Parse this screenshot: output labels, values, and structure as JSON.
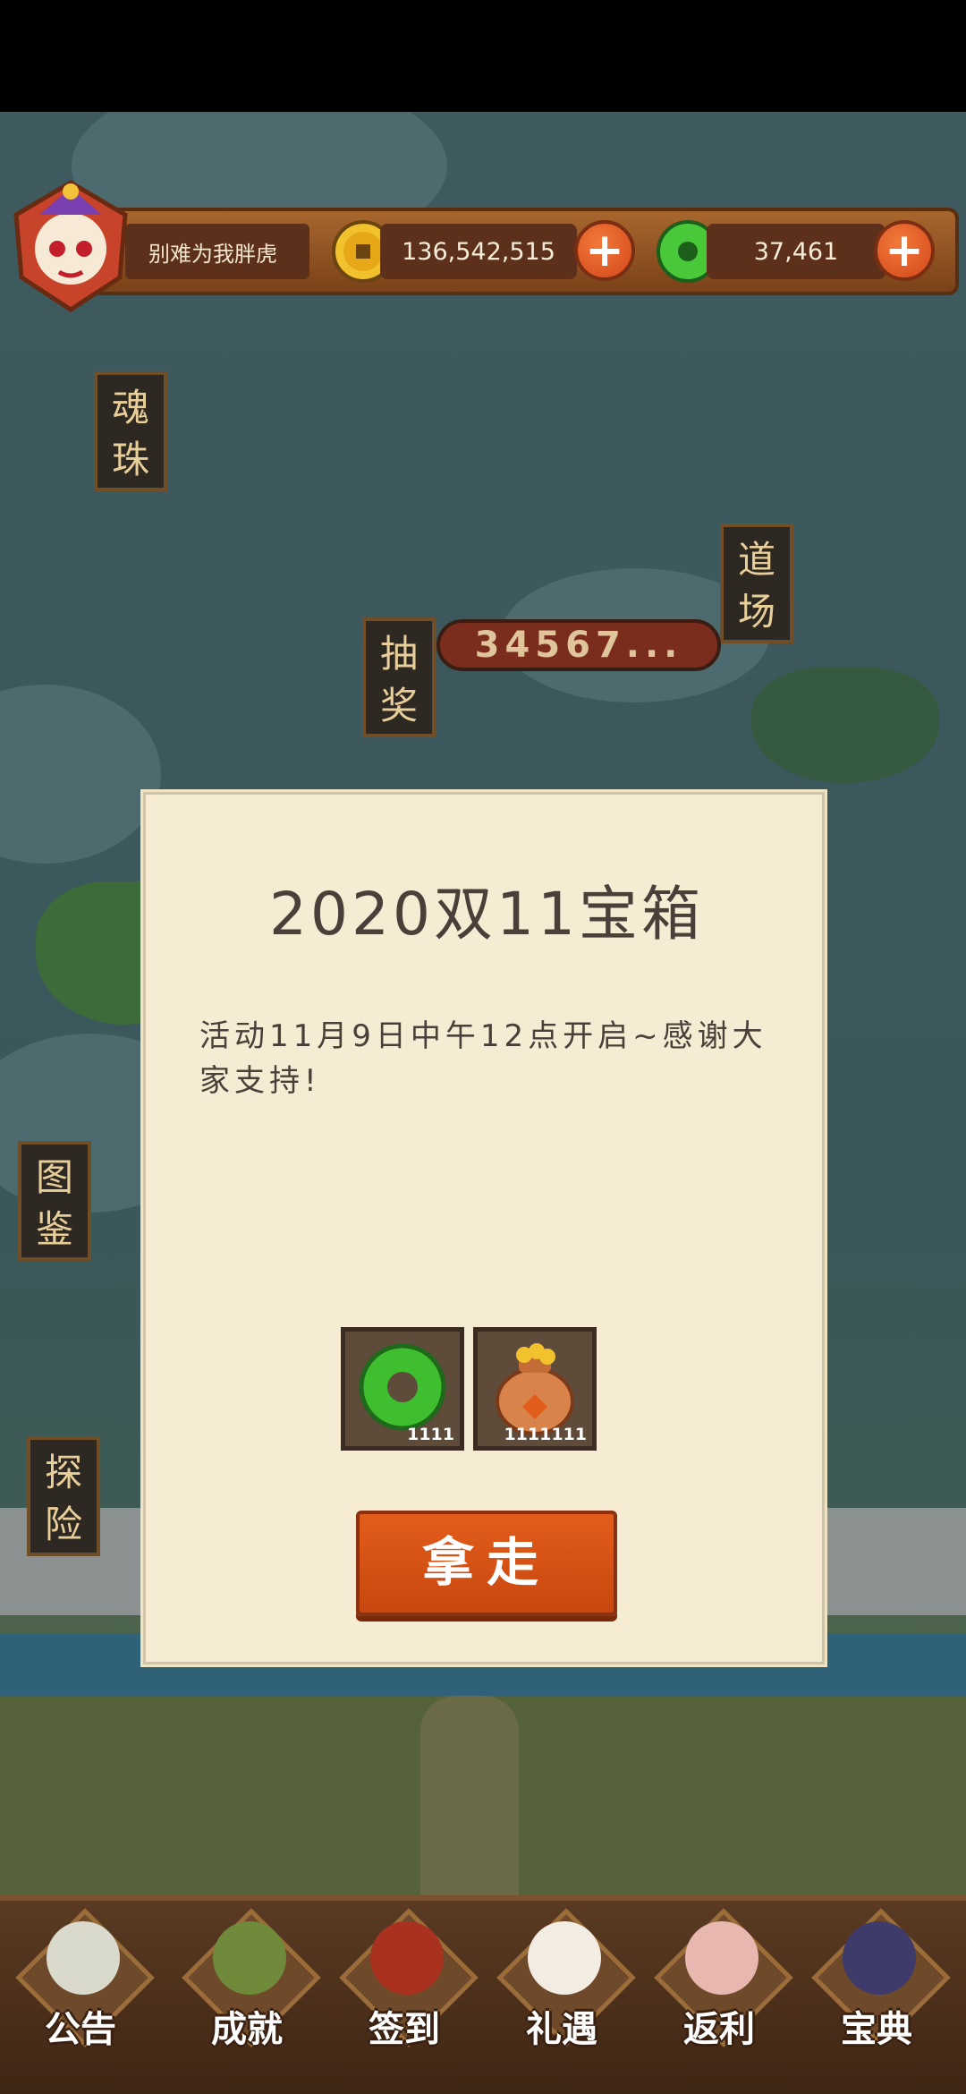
{
  "header": {
    "player_name": "别难为我胖虎",
    "gold_amount": "136,542,515",
    "jade_amount": "37,461",
    "plus_label": "+"
  },
  "side_menu": {
    "soul_orb": "魂珠",
    "dojo": "道场",
    "lottery": "抽奖",
    "codex": "图鉴",
    "explore": "探险"
  },
  "lottery_counter": "34567...",
  "modal": {
    "title": "2020双11宝箱",
    "body": "活动11月9日中午12点开启~感谢大家支持!",
    "rewards": [
      {
        "icon": "jade-ring-icon",
        "count": "1111"
      },
      {
        "icon": "coin-bag-icon",
        "count": "1111111"
      }
    ],
    "take_button": "拿走"
  },
  "bottom_nav": [
    {
      "label": "公告",
      "icon": "announcement-icon"
    },
    {
      "label": "成就",
      "icon": "achievement-icon"
    },
    {
      "label": "签到",
      "icon": "checkin-icon"
    },
    {
      "label": "礼遇",
      "icon": "gift-icon"
    },
    {
      "label": "返利",
      "icon": "rebate-icon"
    },
    {
      "label": "宝典",
      "icon": "guidebook-icon"
    }
  ],
  "colors": {
    "accent_orange": "#d4561a",
    "parchment": "#f5ecd3",
    "wood": "#7a4219",
    "jade": "#3fbf2f",
    "gold": "#e9b423"
  }
}
